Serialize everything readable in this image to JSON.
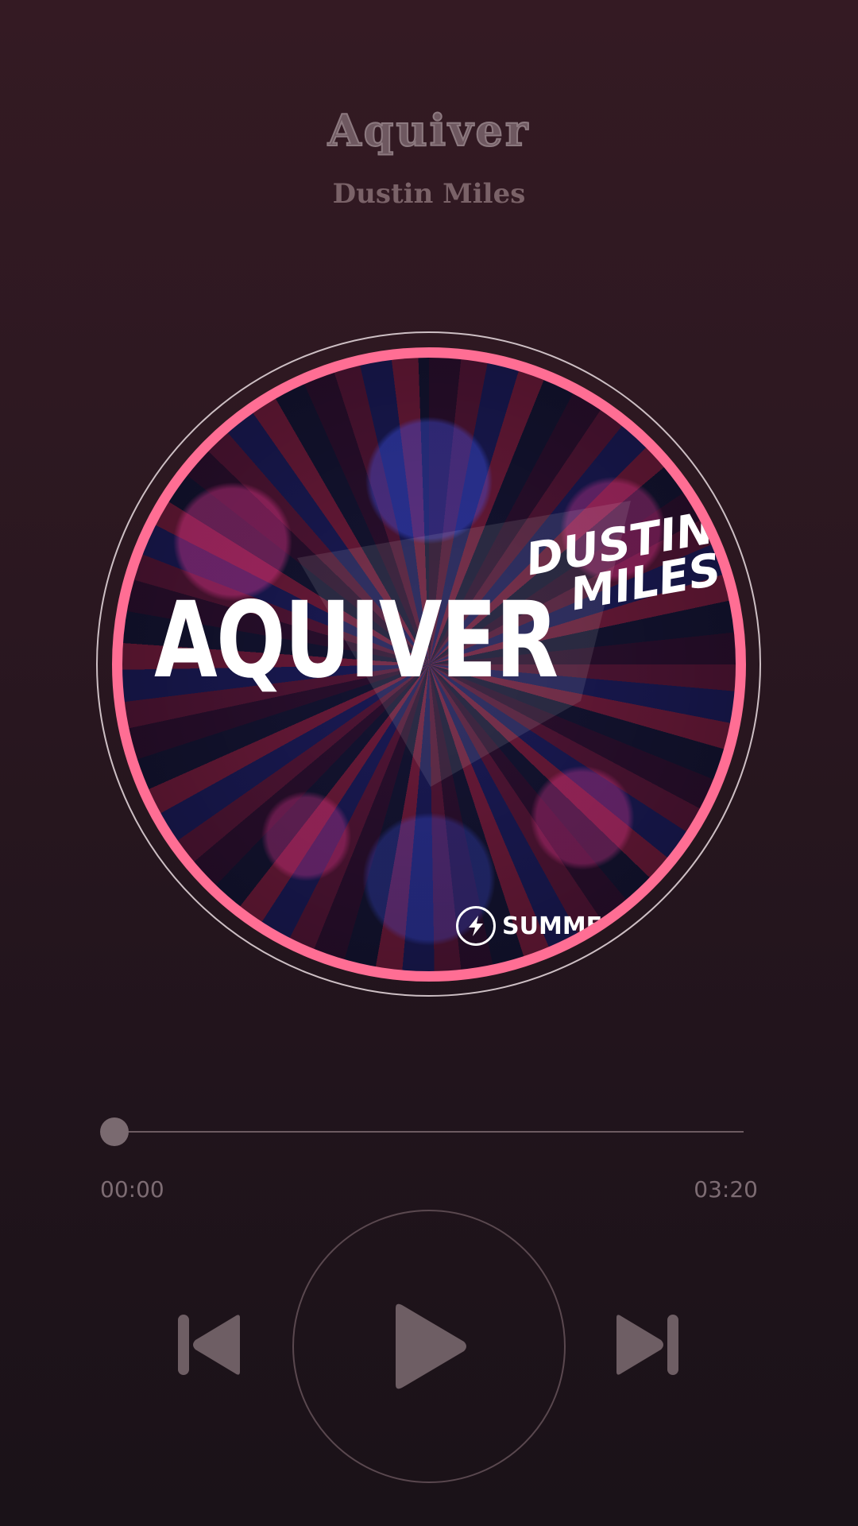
{
  "track": {
    "title": "Aquiver",
    "artist": "Dustin Miles"
  },
  "album_art": {
    "title_text": "AQUIVER",
    "artist_line1": "DUSTIN",
    "artist_line2": "MILES",
    "label_text": "SUMME",
    "ring_color": "#ff6e94"
  },
  "player": {
    "current_time": "00:00",
    "total_time": "03:20",
    "progress": 0
  },
  "controls": {
    "prev_icon": "skip-previous-icon",
    "play_icon": "play-icon",
    "next_icon": "skip-next-icon"
  }
}
